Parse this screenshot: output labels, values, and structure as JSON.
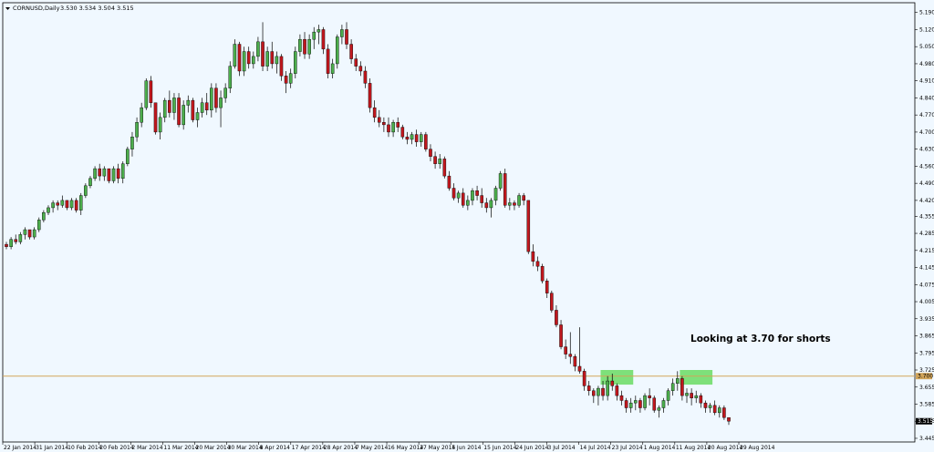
{
  "header": {
    "symbol": "CORNUSD,Daily",
    "ohlc": "3.530 3.534 3.504 3.515",
    "menu_icon": "triangle-down-icon"
  },
  "colors": {
    "background": "#f0f8ff",
    "bull": "#4cae4c",
    "bear": "#c0171d",
    "wick": "#000000",
    "level_line": "#d2a55a",
    "highlight": "#7ee07a",
    "last_price_bg": "#000000",
    "last_price_fg": "#ffffff"
  },
  "chart_data": {
    "type": "candlestick",
    "title": "CORNUSD,Daily",
    "ylim": [
      3.43,
      5.23
    ],
    "yticks": [
      "5.190",
      "5.120",
      "5.050",
      "4.980",
      "4.910",
      "4.840",
      "4.770",
      "4.700",
      "4.630",
      "4.560",
      "4.490",
      "4.420",
      "4.355",
      "4.285",
      "4.215",
      "4.145",
      "4.075",
      "4.005",
      "3.935",
      "3.865",
      "3.795",
      "3.725",
      "3.655",
      "3.585",
      "3.515",
      "3.445"
    ],
    "xticks": [
      "22 Jan 2014",
      "31 Jan 2014",
      "10 Feb 2014",
      "20 Feb 2014",
      "2 Mar 2014",
      "11 Mar 2014",
      "20 Mar 2014",
      "30 Mar 2014",
      "8 Apr 2014",
      "17 Apr 2014",
      "28 Apr 2014",
      "7 May 2014",
      "16 May 2014",
      "27 May 2014",
      "5 Jun 2014",
      "15 Jun 2014",
      "24 Jun 2014",
      "3 Jul 2014",
      "14 Jul 2014",
      "23 Jul 2014",
      "1 Aug 2014",
      "11 Aug 2014",
      "20 Aug 2014",
      "29 Aug 2014"
    ],
    "level_line": {
      "value": 3.7,
      "label": "3.700"
    },
    "last_price": {
      "value": 3.515,
      "label": "3.515"
    },
    "annotation": "Looking at 3.70 for shorts",
    "highlight_zones": [
      {
        "start_index": 128,
        "end_index": 134,
        "low": 3.665,
        "high": 3.725
      },
      {
        "start_index": 145,
        "end_index": 151,
        "low": 3.665,
        "high": 3.725
      }
    ],
    "candles": [
      [
        4.24,
        4.25,
        4.22,
        4.23
      ],
      [
        4.23,
        4.27,
        4.22,
        4.26
      ],
      [
        4.26,
        4.28,
        4.24,
        4.25
      ],
      [
        4.25,
        4.29,
        4.24,
        4.28
      ],
      [
        4.28,
        4.31,
        4.26,
        4.3
      ],
      [
        4.3,
        4.3,
        4.26,
        4.27
      ],
      [
        4.27,
        4.31,
        4.26,
        4.3
      ],
      [
        4.3,
        4.35,
        4.29,
        4.34
      ],
      [
        4.34,
        4.38,
        4.33,
        4.37
      ],
      [
        4.37,
        4.4,
        4.36,
        4.39
      ],
      [
        4.39,
        4.42,
        4.37,
        4.41
      ],
      [
        4.41,
        4.42,
        4.38,
        4.4
      ],
      [
        4.4,
        4.44,
        4.39,
        4.42
      ],
      [
        4.42,
        4.42,
        4.38,
        4.39
      ],
      [
        4.39,
        4.43,
        4.38,
        4.42
      ],
      [
        4.42,
        4.43,
        4.37,
        4.38
      ],
      [
        4.38,
        4.45,
        4.36,
        4.44
      ],
      [
        4.44,
        4.49,
        4.43,
        4.48
      ],
      [
        4.48,
        4.52,
        4.47,
        4.51
      ],
      [
        4.51,
        4.56,
        4.5,
        4.55
      ],
      [
        4.55,
        4.57,
        4.5,
        4.52
      ],
      [
        4.52,
        4.56,
        4.5,
        4.55
      ],
      [
        4.55,
        4.55,
        4.49,
        4.5
      ],
      [
        4.5,
        4.56,
        4.49,
        4.55
      ],
      [
        4.55,
        4.57,
        4.49,
        4.51
      ],
      [
        4.51,
        4.58,
        4.49,
        4.57
      ],
      [
        4.57,
        4.64,
        4.56,
        4.63
      ],
      [
        4.63,
        4.7,
        4.6,
        4.68
      ],
      [
        4.68,
        4.76,
        4.66,
        4.74
      ],
      [
        4.74,
        4.82,
        4.72,
        4.8
      ],
      [
        4.8,
        4.92,
        4.79,
        4.91
      ],
      [
        4.91,
        4.93,
        4.8,
        4.82
      ],
      [
        4.82,
        4.82,
        4.69,
        4.7
      ],
      [
        4.7,
        4.78,
        4.67,
        4.76
      ],
      [
        4.76,
        4.84,
        4.74,
        4.83
      ],
      [
        4.83,
        4.87,
        4.76,
        4.78
      ],
      [
        4.78,
        4.86,
        4.75,
        4.84
      ],
      [
        4.84,
        4.86,
        4.72,
        4.73
      ],
      [
        4.73,
        4.83,
        4.71,
        4.81
      ],
      [
        4.81,
        4.85,
        4.78,
        4.83
      ],
      [
        4.83,
        4.84,
        4.74,
        4.75
      ],
      [
        4.75,
        4.8,
        4.72,
        4.78
      ],
      [
        4.78,
        4.84,
        4.76,
        4.82
      ],
      [
        4.82,
        4.86,
        4.77,
        4.79
      ],
      [
        4.79,
        4.9,
        4.76,
        4.88
      ],
      [
        4.88,
        4.9,
        4.78,
        4.8
      ],
      [
        4.8,
        4.87,
        4.72,
        4.84
      ],
      [
        4.84,
        4.9,
        4.82,
        4.88
      ],
      [
        4.88,
        4.99,
        4.86,
        4.97
      ],
      [
        4.97,
        5.08,
        4.96,
        5.06
      ],
      [
        5.06,
        5.07,
        4.93,
        4.95
      ],
      [
        4.95,
        5.05,
        4.93,
        5.03
      ],
      [
        5.03,
        5.05,
        4.96,
        4.98
      ],
      [
        4.98,
        5.03,
        4.96,
        5.01
      ],
      [
        5.01,
        5.09,
        4.99,
        5.07
      ],
      [
        5.07,
        5.15,
        4.95,
        4.97
      ],
      [
        4.97,
        5.05,
        4.95,
        5.03
      ],
      [
        5.03,
        5.07,
        4.96,
        4.98
      ],
      [
        4.98,
        5.03,
        4.94,
        5.01
      ],
      [
        5.01,
        5.02,
        4.91,
        4.93
      ],
      [
        4.93,
        4.95,
        4.86,
        4.9
      ],
      [
        4.9,
        4.96,
        4.88,
        4.94
      ],
      [
        4.94,
        5.05,
        4.92,
        5.03
      ],
      [
        5.03,
        5.1,
        5.01,
        5.08
      ],
      [
        5.08,
        5.11,
        5.0,
        5.02
      ],
      [
        5.02,
        5.1,
        5.0,
        5.08
      ],
      [
        5.08,
        5.13,
        5.04,
        5.11
      ],
      [
        5.11,
        5.14,
        5.06,
        5.12
      ],
      [
        5.12,
        5.13,
        5.02,
        5.04
      ],
      [
        5.04,
        5.06,
        4.92,
        4.94
      ],
      [
        4.94,
        5.0,
        4.92,
        4.98
      ],
      [
        4.98,
        5.1,
        4.96,
        5.09
      ],
      [
        5.09,
        5.14,
        5.06,
        5.12
      ],
      [
        5.12,
        5.15,
        5.04,
        5.06
      ],
      [
        5.06,
        5.08,
        4.98,
        5.0
      ],
      [
        5.0,
        5.02,
        4.95,
        4.97
      ],
      [
        4.97,
        4.99,
        4.93,
        4.95
      ],
      [
        4.95,
        4.97,
        4.88,
        4.9
      ],
      [
        4.9,
        4.92,
        4.78,
        4.8
      ],
      [
        4.8,
        4.83,
        4.74,
        4.76
      ],
      [
        4.76,
        4.79,
        4.72,
        4.74
      ],
      [
        4.74,
        4.76,
        4.7,
        4.73
      ],
      [
        4.73,
        4.76,
        4.68,
        4.7
      ],
      [
        4.7,
        4.75,
        4.68,
        4.74
      ],
      [
        4.74,
        4.76,
        4.7,
        4.72
      ],
      [
        4.72,
        4.73,
        4.67,
        4.68
      ],
      [
        4.68,
        4.7,
        4.65,
        4.67
      ],
      [
        4.67,
        4.7,
        4.65,
        4.69
      ],
      [
        4.69,
        4.71,
        4.64,
        4.66
      ],
      [
        4.66,
        4.7,
        4.64,
        4.69
      ],
      [
        4.69,
        4.7,
        4.62,
        4.63
      ],
      [
        4.63,
        4.65,
        4.58,
        4.6
      ],
      [
        4.6,
        4.62,
        4.55,
        4.57
      ],
      [
        4.57,
        4.61,
        4.55,
        4.59
      ],
      [
        4.59,
        4.6,
        4.51,
        4.52
      ],
      [
        4.52,
        4.54,
        4.46,
        4.47
      ],
      [
        4.47,
        4.49,
        4.42,
        4.43
      ],
      [
        4.43,
        4.46,
        4.41,
        4.45
      ],
      [
        4.45,
        4.47,
        4.39,
        4.4
      ],
      [
        4.4,
        4.44,
        4.38,
        4.42
      ],
      [
        4.42,
        4.47,
        4.4,
        4.46
      ],
      [
        4.46,
        4.48,
        4.42,
        4.44
      ],
      [
        4.44,
        4.47,
        4.39,
        4.41
      ],
      [
        4.41,
        4.43,
        4.37,
        4.39
      ],
      [
        4.39,
        4.43,
        4.35,
        4.42
      ],
      [
        4.42,
        4.48,
        4.4,
        4.47
      ],
      [
        4.47,
        4.54,
        4.46,
        4.53
      ],
      [
        4.53,
        4.55,
        4.39,
        4.4
      ],
      [
        4.4,
        4.43,
        4.38,
        4.41
      ],
      [
        4.41,
        4.42,
        4.38,
        4.4
      ],
      [
        4.4,
        4.45,
        4.39,
        4.44
      ],
      [
        4.44,
        4.45,
        4.4,
        4.42
      ],
      [
        4.42,
        4.42,
        4.2,
        4.21
      ],
      [
        4.21,
        4.24,
        4.15,
        4.17
      ],
      [
        4.17,
        4.19,
        4.13,
        4.15
      ],
      [
        4.15,
        4.16,
        4.08,
        4.09
      ],
      [
        4.09,
        4.1,
        4.02,
        4.04
      ],
      [
        4.04,
        4.05,
        3.96,
        3.97
      ],
      [
        3.97,
        3.99,
        3.9,
        3.91
      ],
      [
        3.91,
        3.93,
        3.81,
        3.82
      ],
      [
        3.82,
        3.85,
        3.77,
        3.79
      ],
      [
        3.79,
        3.88,
        3.75,
        3.78
      ],
      [
        3.78,
        3.79,
        3.72,
        3.74
      ],
      [
        3.74,
        3.9,
        3.71,
        3.72
      ],
      [
        3.72,
        3.73,
        3.64,
        3.66
      ],
      [
        3.66,
        3.68,
        3.62,
        3.64
      ],
      [
        3.64,
        3.65,
        3.59,
        3.62
      ],
      [
        3.62,
        3.66,
        3.58,
        3.65
      ],
      [
        3.65,
        3.68,
        3.6,
        3.62
      ],
      [
        3.62,
        3.7,
        3.6,
        3.68
      ],
      [
        3.68,
        3.71,
        3.64,
        3.66
      ],
      [
        3.66,
        3.67,
        3.6,
        3.62
      ],
      [
        3.62,
        3.64,
        3.58,
        3.6
      ],
      [
        3.6,
        3.61,
        3.55,
        3.57
      ],
      [
        3.57,
        3.61,
        3.55,
        3.59
      ],
      [
        3.59,
        3.62,
        3.56,
        3.6
      ],
      [
        3.6,
        3.61,
        3.55,
        3.57
      ],
      [
        3.57,
        3.63,
        3.56,
        3.62
      ],
      [
        3.62,
        3.65,
        3.58,
        3.61
      ],
      [
        3.61,
        3.62,
        3.55,
        3.56
      ],
      [
        3.56,
        3.58,
        3.53,
        3.57
      ],
      [
        3.57,
        3.61,
        3.55,
        3.6
      ],
      [
        3.6,
        3.65,
        3.58,
        3.64
      ],
      [
        3.64,
        3.69,
        3.62,
        3.67
      ],
      [
        3.67,
        3.72,
        3.64,
        3.69
      ],
      [
        3.69,
        3.7,
        3.6,
        3.62
      ],
      [
        3.62,
        3.65,
        3.59,
        3.63
      ],
      [
        3.63,
        3.65,
        3.58,
        3.61
      ],
      [
        3.61,
        3.64,
        3.59,
        3.62
      ],
      [
        3.62,
        3.63,
        3.57,
        3.59
      ],
      [
        3.59,
        3.6,
        3.55,
        3.57
      ],
      [
        3.57,
        3.59,
        3.55,
        3.58
      ],
      [
        3.58,
        3.6,
        3.54,
        3.55
      ],
      [
        3.55,
        3.58,
        3.53,
        3.57
      ],
      [
        3.57,
        3.58,
        3.52,
        3.53
      ],
      [
        3.53,
        3.53,
        3.5,
        3.515
      ]
    ]
  }
}
